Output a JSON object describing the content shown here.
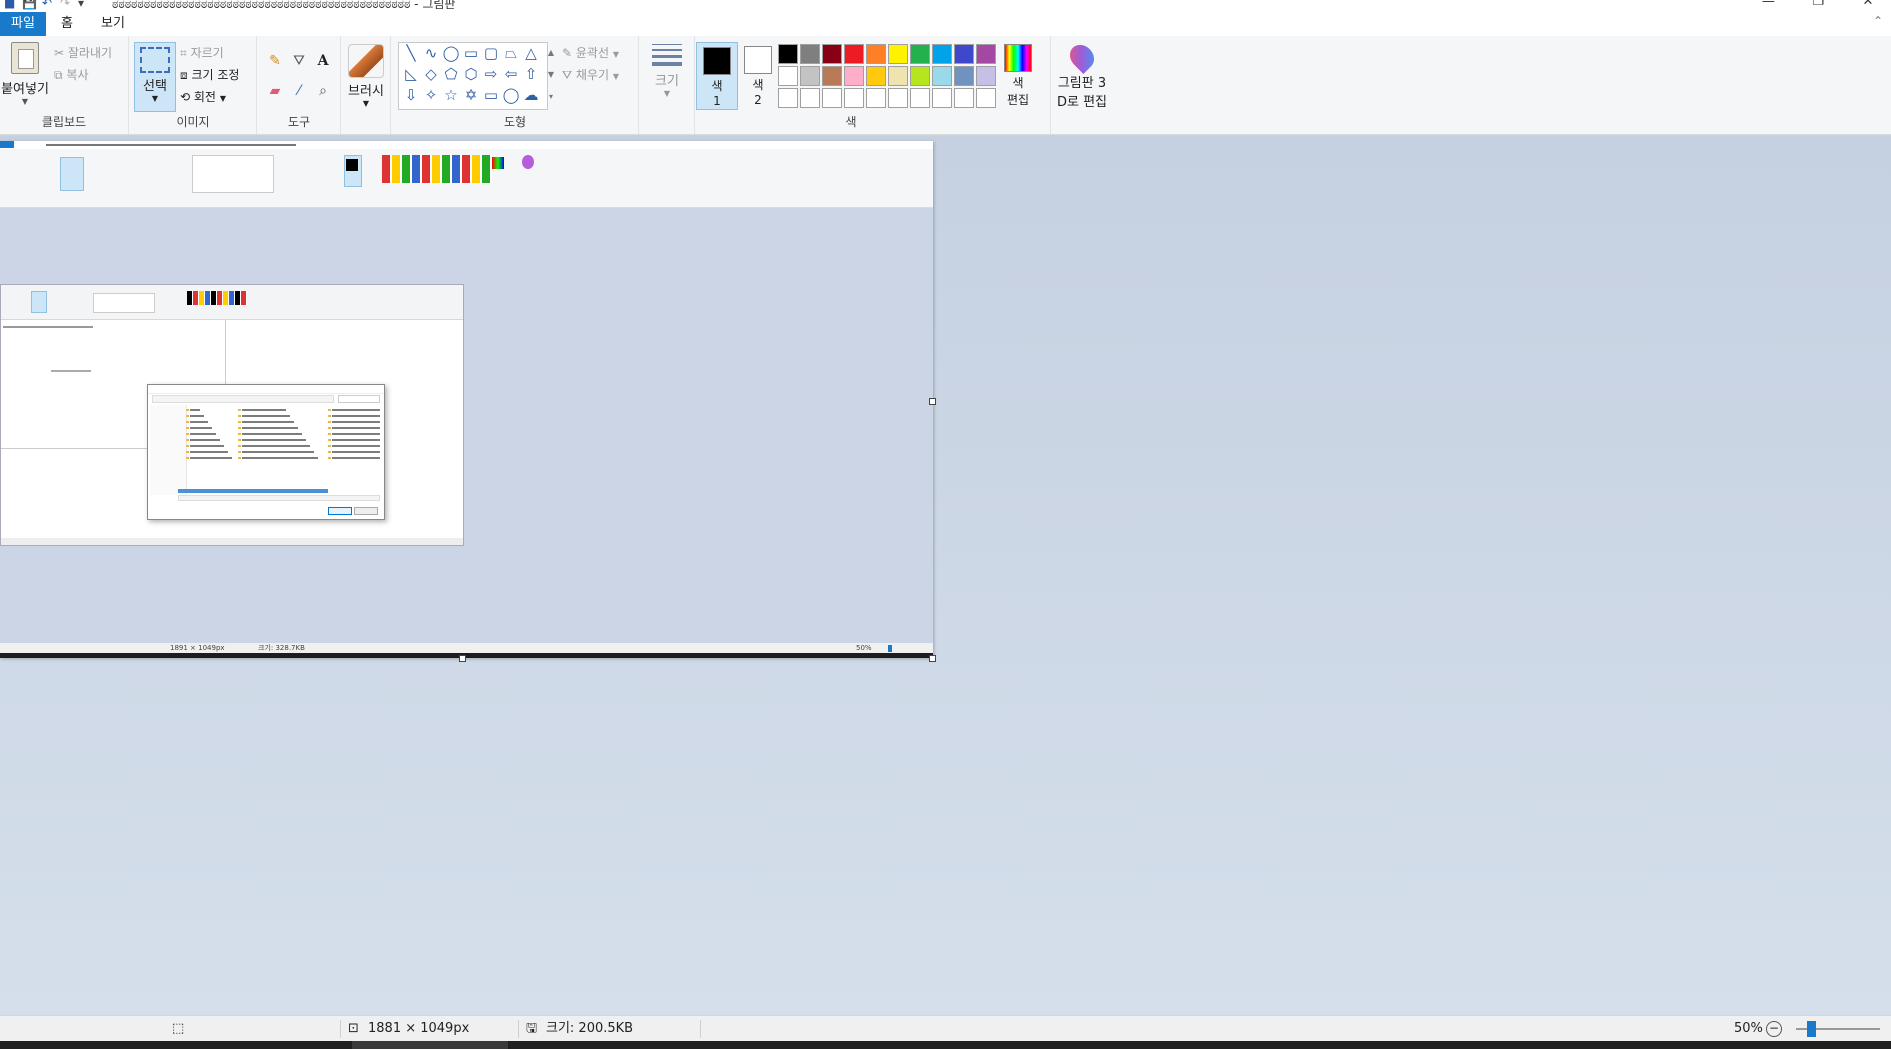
{
  "window": {
    "title": "ಠಠಠಠಠಠಠಠಠಠಠಠಠಠಠಠಠಠಠಠಠಠಠಠಠಠಠಠಠಠಠಠಠಠಠಠಠಠಠಠಠಠಠಠಠಠಠ - 그림판",
    "controls": [
      "—",
      "❐",
      "✕"
    ]
  },
  "tabs": {
    "file": "파일",
    "home": "홈",
    "view": "보기"
  },
  "ribbon": {
    "clipboard": {
      "paste": "붙여넣기",
      "cut": "잘라내기",
      "copy": "복사",
      "label": "클립보드"
    },
    "image": {
      "select": "선택",
      "crop": "자르기",
      "resize": "크기 조정",
      "rotate": "회전",
      "label": "이미지"
    },
    "tools": {
      "label": "도구"
    },
    "brushes": {
      "label": "브러시"
    },
    "shapes": {
      "outline": "윤곽선",
      "fill": "채우기",
      "label": "도형"
    },
    "size": {
      "label": "크기"
    },
    "colors": {
      "color1": "색",
      "color1_num": "1",
      "color2": "색",
      "color2_num": "2",
      "edit_1": "색",
      "edit_2": "편집",
      "label": "색",
      "palette": [
        "#000000",
        "#7f7f7f",
        "#880015",
        "#ed1c24",
        "#ff7f27",
        "#fff200",
        "#22b14c",
        "#00a2e8",
        "#3f48cc",
        "#a349a4",
        "#ffffff",
        "#c3c3c3",
        "#b97a57",
        "#ffaec9",
        "#ffc90e",
        "#efe4b0",
        "#b5e61d",
        "#99d9ea",
        "#7092be",
        "#c8bfe7",
        "#ffffff",
        "#ffffff",
        "#ffffff",
        "#ffffff",
        "#ffffff",
        "#ffffff",
        "#ffffff",
        "#ffffff",
        "#ffffff",
        "#ffffff"
      ],
      "primary": "#000000",
      "secondary": "#ffffff"
    },
    "paint3d": {
      "line1": "그림판 3",
      "line2": "D로 편집"
    }
  },
  "mini": {
    "status_size": "1891 × 1049px",
    "status_file": "크기: 328.7KB",
    "zoom": "50%"
  },
  "status": {
    "dimensions": "1881 × 1049px",
    "filesize": "크기: 200.5KB",
    "zoom": "50%",
    "zoom_level": 0.5
  }
}
